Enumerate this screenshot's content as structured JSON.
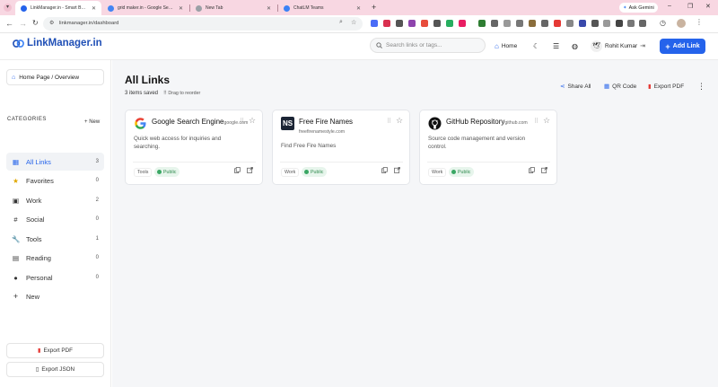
{
  "browser": {
    "tabs": [
      {
        "label": "LinkManager.in - Smart Bookm...",
        "active": true,
        "color": "#2563eb"
      },
      {
        "label": "grid maker.in - Google Search",
        "active": false,
        "color": "#4285f4"
      },
      {
        "label": "New Tab",
        "active": false,
        "color": "#9aa0a6"
      },
      {
        "label": "ChatLM Teams",
        "active": false,
        "color": "#3b82f6"
      }
    ],
    "ask_gemini": "Ask Gemini",
    "url": "linkmanager.in/dashboard"
  },
  "header": {
    "brand": "LinkManager.in",
    "search_placeholder": "Search links or tags...",
    "home_label": "Home",
    "user_name": "Rohit Kumar",
    "add_link_label": "Add Link"
  },
  "sidebar": {
    "home_overview": "Home Page / Overview",
    "categories_title": "CATEGORIES",
    "new_label": "New",
    "categories": [
      {
        "label": "All Links",
        "count": "3",
        "icon": "grid-icon",
        "active": true
      },
      {
        "label": "Favorites",
        "count": "0",
        "icon": "star-icon"
      },
      {
        "label": "Work",
        "count": "2",
        "icon": "briefcase-icon"
      },
      {
        "label": "Social",
        "count": "0",
        "icon": "hash-icon"
      },
      {
        "label": "Tools",
        "count": "1",
        "icon": "wrench-icon"
      },
      {
        "label": "Reading",
        "count": "0",
        "icon": "book-icon"
      },
      {
        "label": "Personal",
        "count": "0",
        "icon": "person-icon"
      },
      {
        "label": "New",
        "count": "",
        "icon": "plus-icon"
      }
    ],
    "export_pdf": "Export PDF",
    "export_json": "Export JSON"
  },
  "main": {
    "title": "All Links",
    "items_saved": "3 items saved",
    "drag_hint": "Drag to reorder",
    "share_all": "Share All",
    "qr_code": "QR Code",
    "export_pdf": "Export PDF",
    "cards": [
      {
        "title": "Google Search Engine",
        "domain": "google.com",
        "description": "Quick web access for inquiries and searching.",
        "tag": "Tools",
        "visibility": "Public",
        "logo": "google-logo-icon"
      },
      {
        "title": "Free Fire Names",
        "domain": "freefirenamestyle.com",
        "description": "Find Free Fire Names",
        "tag": "Work",
        "visibility": "Public",
        "logo": "ns-logo-icon"
      },
      {
        "title": "GitHub Repository",
        "domain": "github.com",
        "description": "Source code management and version control.",
        "tag": "Work",
        "visibility": "Public",
        "logo": "github-logo-icon"
      }
    ]
  },
  "colors": {
    "accent": "#2563eb",
    "brand": "#1f4fb6",
    "public": "#2f8a4e",
    "tab_strip": "#f8d7e2"
  }
}
